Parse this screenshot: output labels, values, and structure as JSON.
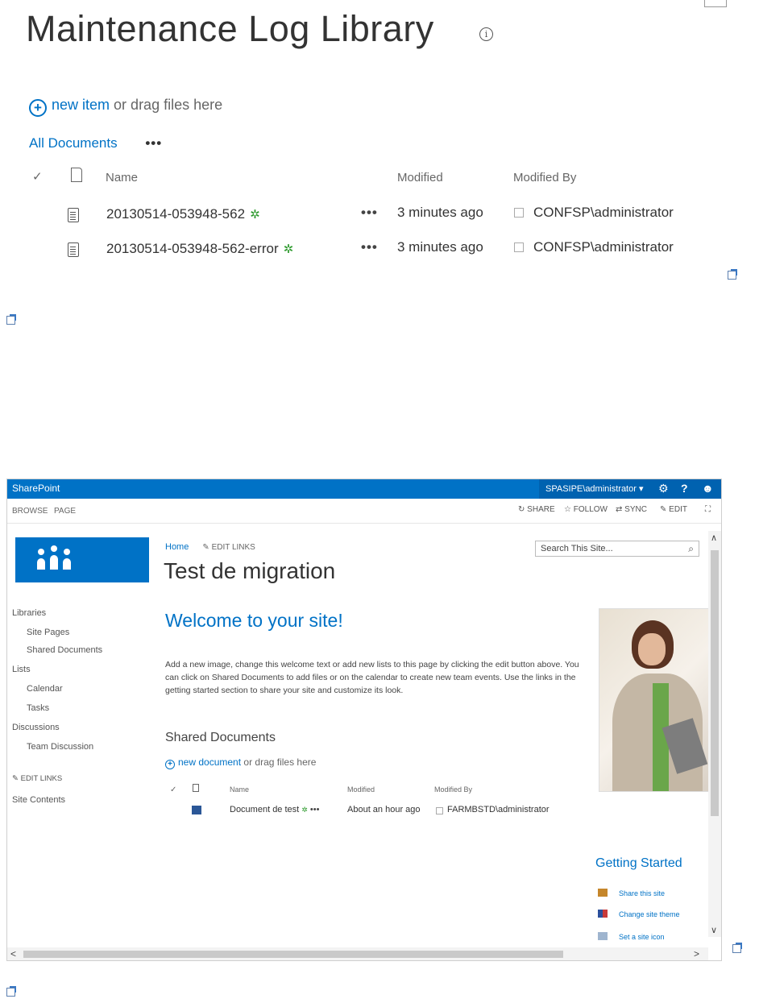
{
  "library": {
    "title": "Maintenance Log Library",
    "new_item_link": "new item",
    "new_item_suffix": "or drag files here",
    "view_all": "All Documents",
    "view_more": "•••",
    "columns": {
      "name": "Name",
      "modified": "Modified",
      "modified_by": "Modified By"
    },
    "rows": [
      {
        "name": "20130514-053948-562",
        "new_marker": "✲",
        "menu": "•••",
        "modified": "3 minutes ago",
        "modified_by": "CONFSP\\administrator"
      },
      {
        "name": "20130514-053948-562-error",
        "new_marker": "✲",
        "menu": "•••",
        "modified": "3 minutes ago",
        "modified_by": "CONFSP\\administrator"
      }
    ]
  },
  "sharepoint": {
    "brand": "SharePoint",
    "user": "SPASIPE\\administrator ▾",
    "ribbon_tabs": [
      "BROWSE",
      "PAGE"
    ],
    "actions": [
      "SHARE",
      "FOLLOW",
      "SYNC",
      "EDIT"
    ],
    "breadcrumb_home": "Home",
    "edit_links": "EDIT LINKS",
    "site_title": "Test de migration",
    "search_placeholder": "Search This Site...",
    "nav": [
      "Libraries",
      "Site Pages",
      "Shared Documents",
      "Lists",
      "Calendar",
      "Tasks",
      "Discussions",
      "Team Discussion",
      "EDIT LINKS",
      "Site Contents"
    ],
    "welcome": "Welcome to your site!",
    "welcome_text": "Add a new image, change this welcome text or add new lists to this page by clicking the edit button above. You can click on Shared Documents to add files or on the calendar to create new team events. Use the links in the getting started section to share your site and customize its look.",
    "shared_docs_title": "Shared Documents",
    "new_document_link": "new document",
    "new_document_suffix": "or drag files here",
    "doc_columns": {
      "name": "Name",
      "modified": "Modified",
      "modified_by": "Modified By"
    },
    "doc_row": {
      "name": "Document de test",
      "modified": "About an hour ago",
      "modified_by": "FARMBSTD\\administrator"
    },
    "getting_started": "Getting Started",
    "gs_items": [
      "Share this site",
      "Change site theme",
      "Set a site icon"
    ]
  },
  "colors": {
    "accent": "#0072c6",
    "new_marker": "#2d9a2d"
  }
}
